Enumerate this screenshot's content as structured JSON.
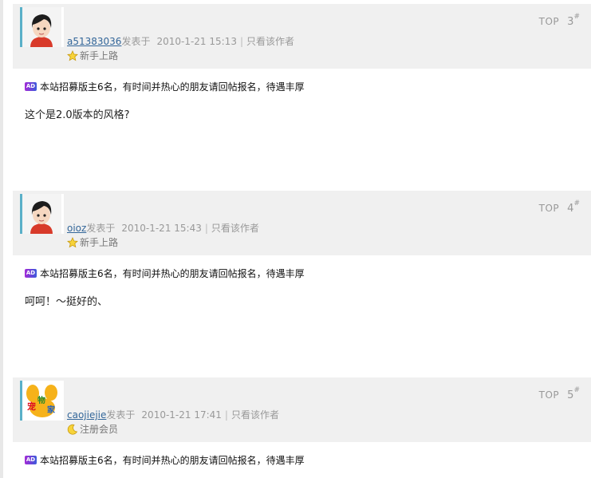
{
  "posts": [
    {
      "author": "a51383036",
      "posted_label": "发表于",
      "time": "2010-1-21 15:13",
      "only_author": "只看该作者",
      "rank": "新手上路",
      "rank_icon": "star-icon",
      "top_label": "TOP",
      "floor": "3",
      "floor_mark": "#",
      "ad_badge": "AD",
      "ad_text": "本站招募版主6名，有时间并热心的朋友请回帖报名，待遇丰厚",
      "content": "这个是2.0版本的风格?"
    },
    {
      "author": "oioz",
      "posted_label": "发表于",
      "time": "2010-1-21 15:43",
      "only_author": "只看该作者",
      "rank": "新手上路",
      "rank_icon": "star-icon",
      "top_label": "TOP",
      "floor": "4",
      "floor_mark": "#",
      "ad_badge": "AD",
      "ad_text": "本站招募版主6名，有时间并热心的朋友请回帖报名，待遇丰厚",
      "content": "呵呵！～挺好的、"
    },
    {
      "author": "caojiejie",
      "posted_label": "发表于",
      "time": "2010-1-21 17:41",
      "only_author": "只看该作者",
      "rank": "注册会员",
      "rank_icon": "moon-icon",
      "top_label": "TOP",
      "floor": "5",
      "floor_mark": "#",
      "ad_badge": "AD",
      "ad_text": "本站招募版主6名，有时间并热心的朋友请回帖报名，待遇丰厚",
      "content": ""
    }
  ],
  "colors": {
    "header_bg": "#f0f0f0",
    "author_link": "#336699",
    "avatar_border": "#5ab0c8",
    "ad_badge": "#7a3bd6"
  }
}
